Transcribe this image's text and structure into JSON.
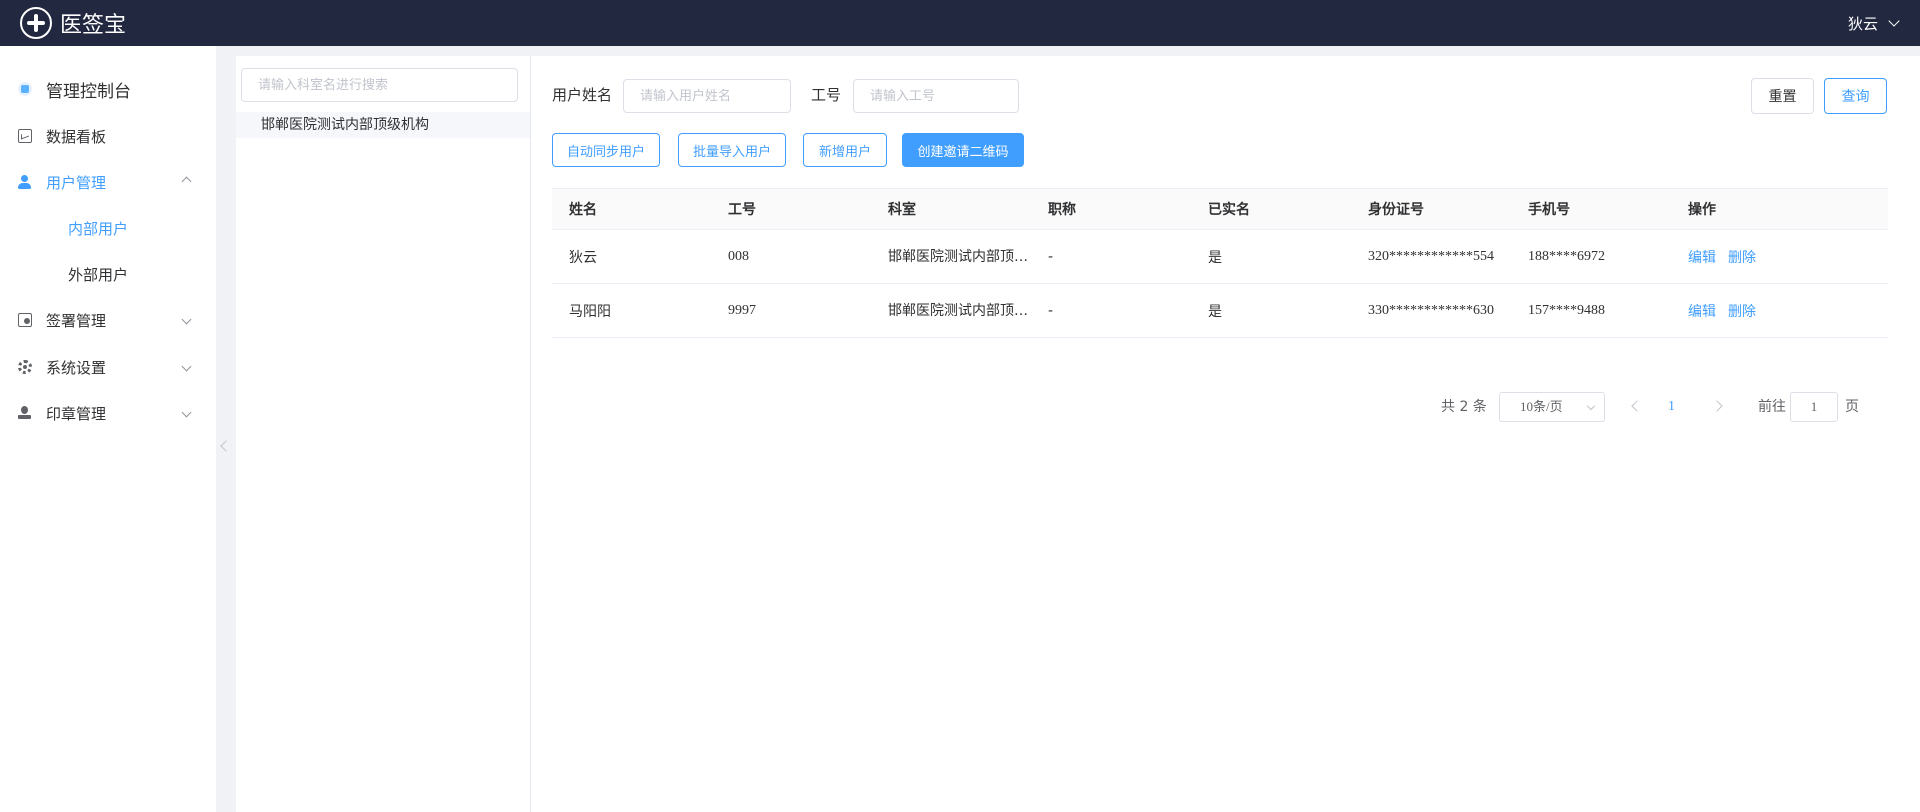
{
  "header": {
    "app_name": "医签宝",
    "user_name": "狄云"
  },
  "sidebar": {
    "title": "管理控制台",
    "items": [
      {
        "label": "数据看板"
      },
      {
        "label": "用户管理"
      },
      {
        "label": "内部用户"
      },
      {
        "label": "外部用户"
      },
      {
        "label": "签署管理"
      },
      {
        "label": "系统设置"
      },
      {
        "label": "印章管理"
      }
    ]
  },
  "dept_panel": {
    "search_placeholder": "请输入科室名进行搜索",
    "root_node": "邯郸医院测试内部顶级机构"
  },
  "filters": {
    "name_label": "用户姓名",
    "name_placeholder": "请输入用户姓名",
    "id_label": "工号",
    "id_placeholder": "请输入工号",
    "reset": "重置",
    "query": "查询"
  },
  "actions": {
    "auto_sync": "自动同步用户",
    "batch_import": "批量导入用户",
    "add_user": "新增用户",
    "invite_qr": "创建邀请二维码"
  },
  "table": {
    "headers": [
      "姓名",
      "工号",
      "科室",
      "职称",
      "已实名",
      "身份证号",
      "手机号",
      "操作"
    ],
    "rows": [
      {
        "name": "狄云",
        "emp_id": "008",
        "dept": "邯郸医院测试内部顶级机构",
        "title": "-",
        "verified": "是",
        "id_card": "320************554",
        "phone": "188****6972",
        "edit": "编辑",
        "delete": "删除"
      },
      {
        "name": "马阳阳",
        "emp_id": "9997",
        "dept": "邯郸医院测试内部顶级机构",
        "title": "-",
        "verified": "是",
        "id_card": "330************630",
        "phone": "157****9488",
        "edit": "编辑",
        "delete": "删除"
      }
    ]
  },
  "pagination": {
    "total": "共 2 条",
    "page_size": "10条/页",
    "current": "1",
    "goto_label": "前往",
    "goto_value": "1",
    "page_suffix": "页"
  }
}
